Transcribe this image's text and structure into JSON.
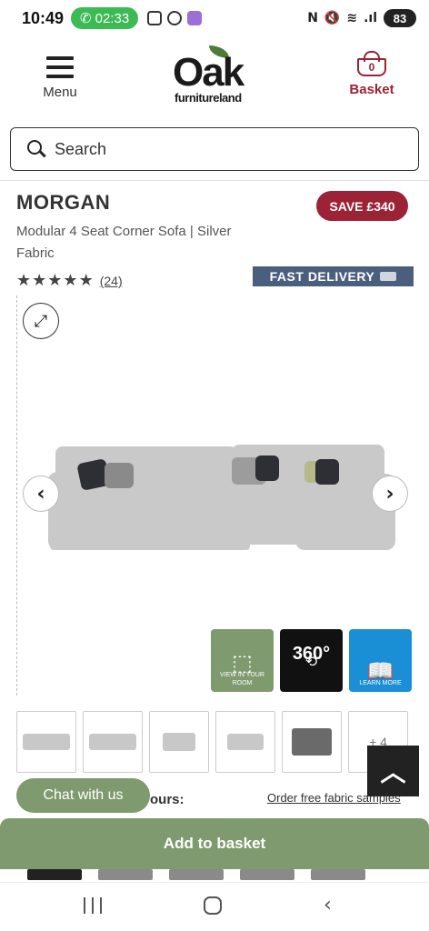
{
  "status_bar": {
    "time": "10:49",
    "call_timer": "02:33",
    "battery": "83"
  },
  "header": {
    "menu_label": "Menu",
    "logo_main": "Oak",
    "logo_sub": "furnitureland",
    "basket_count": "0",
    "basket_label": "Basket"
  },
  "search": {
    "placeholder": "Search"
  },
  "product": {
    "name": "MORGAN",
    "description": "Modular 4 Seat Corner Sofa | Silver Fabric",
    "save_badge": "SAVE £340",
    "rating": 5,
    "review_count": "(24)",
    "delivery_badge": "FAST DELIVERY"
  },
  "feature_tiles": {
    "room_label": "VIEW IN YOUR ROOM",
    "spin_label": "360°",
    "learn_label": "LEARN MORE"
  },
  "thumbnails": {
    "more_label": "+ 4"
  },
  "chat": {
    "label": "Chat with us"
  },
  "colours": {
    "label": "ours:",
    "samples_link": "Order free fabric samples"
  },
  "cta": {
    "add_to_basket": "Add to basket"
  },
  "colors": {
    "brand_green": "#7f9a6e",
    "brand_red": "#9b2335",
    "delivery_blue": "#4a5f7d"
  },
  "icons": [
    "search-icon",
    "menu-icon",
    "basket-icon",
    "expand-icon",
    "chevron-left-icon",
    "chevron-right-icon",
    "truck-icon",
    "chevron-up-icon"
  ]
}
